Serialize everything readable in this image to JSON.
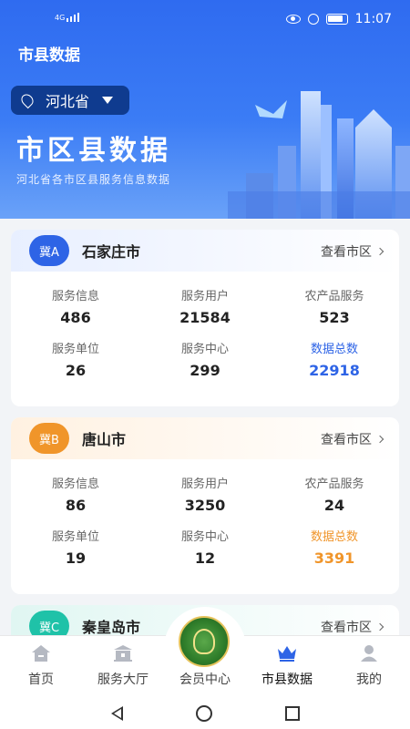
{
  "status": {
    "signal": "4G",
    "time": "11:07"
  },
  "header": {
    "page_title": "市县数据",
    "province": "河北省",
    "hero_title": "市区县数据",
    "hero_subtitle": "河北省各市区县服务信息数据"
  },
  "cards": [
    {
      "badge": "冀A",
      "badge_color": "#2e64e6",
      "city": "石家庄市",
      "link": "查看市区",
      "stats": [
        {
          "label": "服务信息",
          "value": "486"
        },
        {
          "label": "服务用户",
          "value": "21584"
        },
        {
          "label": "农产品服务",
          "value": "523"
        },
        {
          "label": "服务单位",
          "value": "26"
        },
        {
          "label": "服务中心",
          "value": "299"
        },
        {
          "label": "数据总数",
          "value": "22918"
        }
      ]
    },
    {
      "badge": "冀B",
      "badge_color": "#f0952a",
      "city": "唐山市",
      "link": "查看市区",
      "stats": [
        {
          "label": "服务信息",
          "value": "86"
        },
        {
          "label": "服务用户",
          "value": "3250"
        },
        {
          "label": "农产品服务",
          "value": "24"
        },
        {
          "label": "服务单位",
          "value": "19"
        },
        {
          "label": "服务中心",
          "value": "12"
        },
        {
          "label": "数据总数",
          "value": "3391"
        }
      ]
    },
    {
      "badge": "冀C",
      "badge_color": "#1fc2a8",
      "city": "秦皇岛市",
      "link": "查看市区"
    }
  ],
  "nav": {
    "items": [
      {
        "label": "首页",
        "icon": "home-icon"
      },
      {
        "label": "服务大厅",
        "icon": "hall-icon"
      },
      {
        "label": "会员中心",
        "icon": "emblem-icon"
      },
      {
        "label": "市县数据",
        "icon": "crown-icon"
      },
      {
        "label": "我的",
        "icon": "user-icon"
      }
    ]
  },
  "colors": {
    "accent": "#2e64e6",
    "header": "#3b7cf5",
    "orange": "#f0952a",
    "teal": "#1fc2a8"
  }
}
